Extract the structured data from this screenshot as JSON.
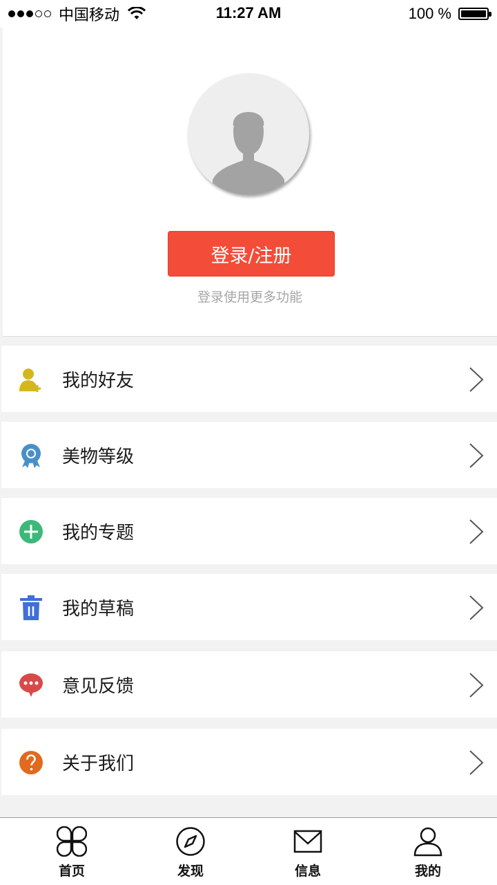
{
  "status_bar": {
    "carrier": "中国移动",
    "time": "11:27 AM",
    "battery": "100 %"
  },
  "profile": {
    "login_button": "登录/注册",
    "login_hint": "登录使用更多功能"
  },
  "menu": [
    {
      "label": "我的好友",
      "icon": "friend-add-icon",
      "color": "#d4b71e"
    },
    {
      "label": "美物等级",
      "icon": "badge-level-icon",
      "color": "#4a90c8"
    },
    {
      "label": "我的专题",
      "icon": "plus-circle-icon",
      "color": "#3db87a"
    },
    {
      "label": "我的草稿",
      "icon": "trash-icon",
      "color": "#3f6fd8"
    },
    {
      "label": "意见反馈",
      "icon": "chat-bubble-icon",
      "color": "#d84a4a"
    },
    {
      "label": "关于我们",
      "icon": "question-circle-icon",
      "color": "#e06a1e"
    }
  ],
  "tab_bar": {
    "tabs": [
      {
        "label": "首页",
        "icon": "clover-home-icon"
      },
      {
        "label": "发现",
        "icon": "compass-icon"
      },
      {
        "label": "信息",
        "icon": "envelope-icon"
      },
      {
        "label": "我的",
        "icon": "person-icon"
      }
    ]
  },
  "colors": {
    "accent": "#f34c38",
    "background": "#f2f2f2"
  }
}
